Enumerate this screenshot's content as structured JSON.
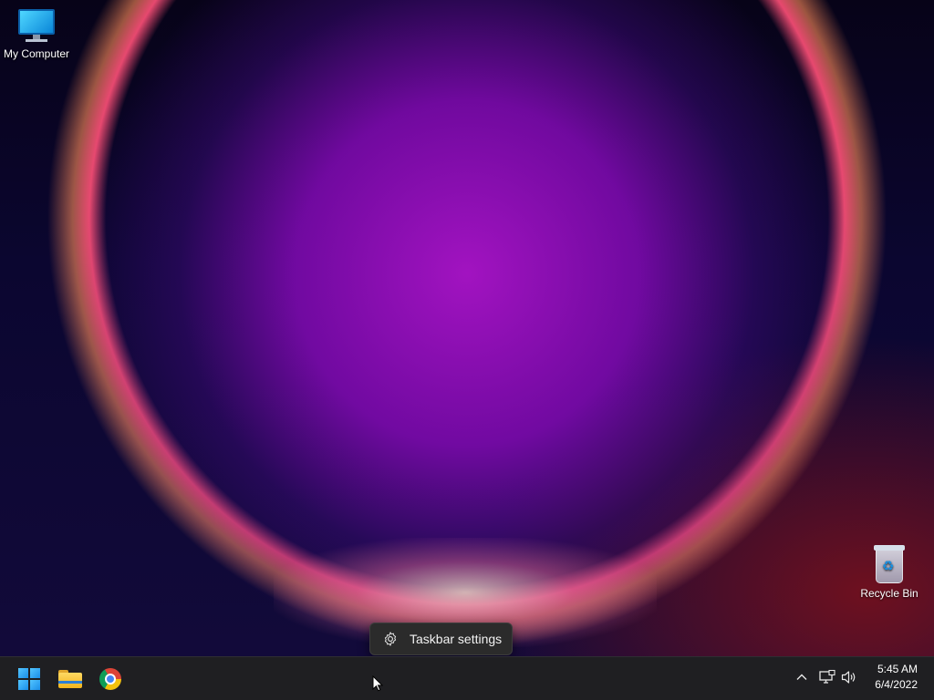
{
  "desktop": {
    "icons": [
      {
        "label": "My Computer",
        "icon": "computer-icon"
      },
      {
        "label": "Recycle Bin",
        "icon": "recycle-bin-icon"
      }
    ]
  },
  "tooltip": {
    "label": "Taskbar settings",
    "icon": "gear-icon"
  },
  "taskbar": {
    "pinned": [
      {
        "name": "start",
        "icon": "windows-logo-icon"
      },
      {
        "name": "file-explorer",
        "icon": "folder-icon"
      },
      {
        "name": "chrome",
        "icon": "chrome-icon"
      }
    ],
    "tray": {
      "icons": [
        "chevron-up-icon",
        "network-icon",
        "volume-icon"
      ],
      "time": "5:45 AM",
      "date": "6/4/2022"
    }
  }
}
